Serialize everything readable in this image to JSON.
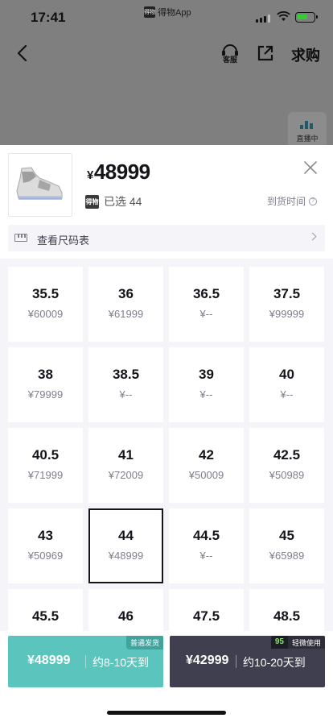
{
  "status_bar": {
    "time": "17:41",
    "app_name": "得物App",
    "app_logo_text": "得物"
  },
  "nav": {
    "back_icon": "chevron-left-icon",
    "service_label": "客服",
    "share_icon": "share-icon",
    "want_buy_label": "求购",
    "live_label": "直播中"
  },
  "product": {
    "currency": "¥",
    "price": "48999",
    "badge_text": "得物",
    "selected_text": "已选 44",
    "arrival_label": "到货时间",
    "arrival_info_icon": "info-icon",
    "image_alt": "sneaker"
  },
  "size_chart": {
    "label": "查看尺码表",
    "icon": "ruler-icon"
  },
  "sizes": [
    {
      "size": "35.5",
      "price": "¥60009"
    },
    {
      "size": "36",
      "price": "¥61999"
    },
    {
      "size": "36.5",
      "price": "¥--"
    },
    {
      "size": "37.5",
      "price": "¥99999"
    },
    {
      "size": "38",
      "price": "¥79999"
    },
    {
      "size": "38.5",
      "price": "¥--"
    },
    {
      "size": "39",
      "price": "¥--"
    },
    {
      "size": "40",
      "price": "¥--"
    },
    {
      "size": "40.5",
      "price": "¥71999"
    },
    {
      "size": "41",
      "price": "¥72009"
    },
    {
      "size": "42",
      "price": "¥50009"
    },
    {
      "size": "42.5",
      "price": "¥50989"
    },
    {
      "size": "43",
      "price": "¥50969"
    },
    {
      "size": "44",
      "price": "¥48999",
      "selected": true
    },
    {
      "size": "44.5",
      "price": "¥--"
    },
    {
      "size": "45",
      "price": "¥65989"
    },
    {
      "size": "45.5",
      "price": ""
    },
    {
      "size": "46",
      "price": ""
    },
    {
      "size": "47.5",
      "price": ""
    },
    {
      "size": "48.5",
      "price": ""
    }
  ],
  "buttons": {
    "normal": {
      "price": "¥48999",
      "days": "约8-10天到",
      "tag": "普通发货",
      "color": "#5bc4bd"
    },
    "used": {
      "price": "¥42999",
      "days": "约10-20天到",
      "grade": "95",
      "tag": "轻微使用",
      "color": "#3f3f4f"
    }
  },
  "colors": {
    "overlay": "#7f7f7f",
    "text_primary": "#14151a",
    "text_secondary": "#7f7f8e",
    "grid_bg": "#f5f5f9"
  }
}
